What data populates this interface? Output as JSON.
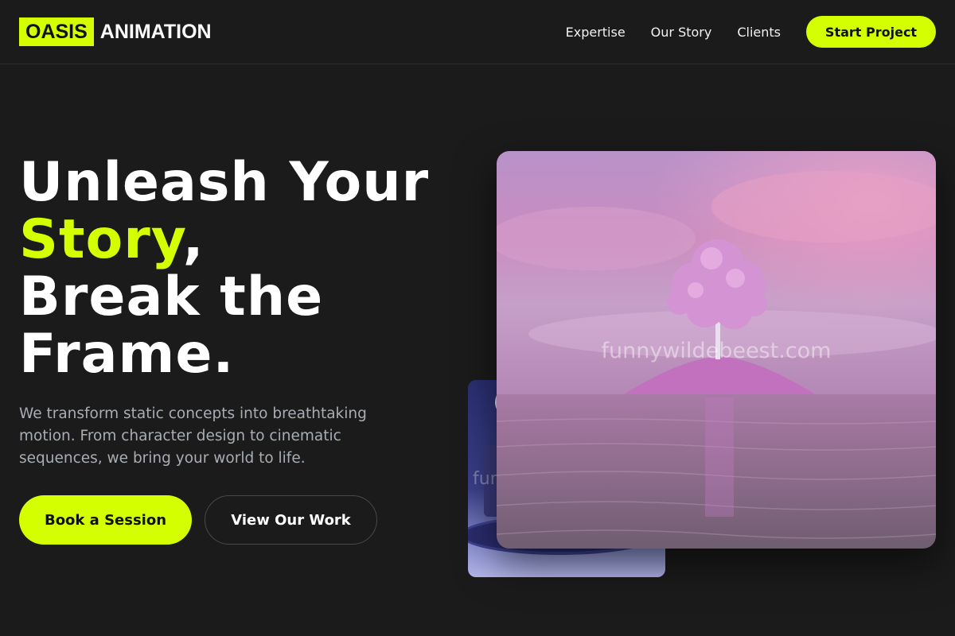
{
  "brand": {
    "logo_box": "OASIS",
    "logo_text": "ANIMATION",
    "accent_color": "#d4ff00"
  },
  "nav": {
    "links": [
      "Expertise",
      "Our Story",
      "Clients"
    ],
    "cta": "Start Project"
  },
  "hero": {
    "line1": "Unleash Your",
    "line2_accent": "Story",
    "line2_rest": ",",
    "line3": "Break the",
    "line4": "Frame.",
    "subtitle": "We transform static concepts into breathtaking motion. From character design to cinematic sequences, we bring your world to life.",
    "primary_button": "Book a Session",
    "secondary_button": "View Our Work"
  },
  "images": {
    "main_watermark": "funnywildebeest.com",
    "back_watermark": "fun"
  }
}
